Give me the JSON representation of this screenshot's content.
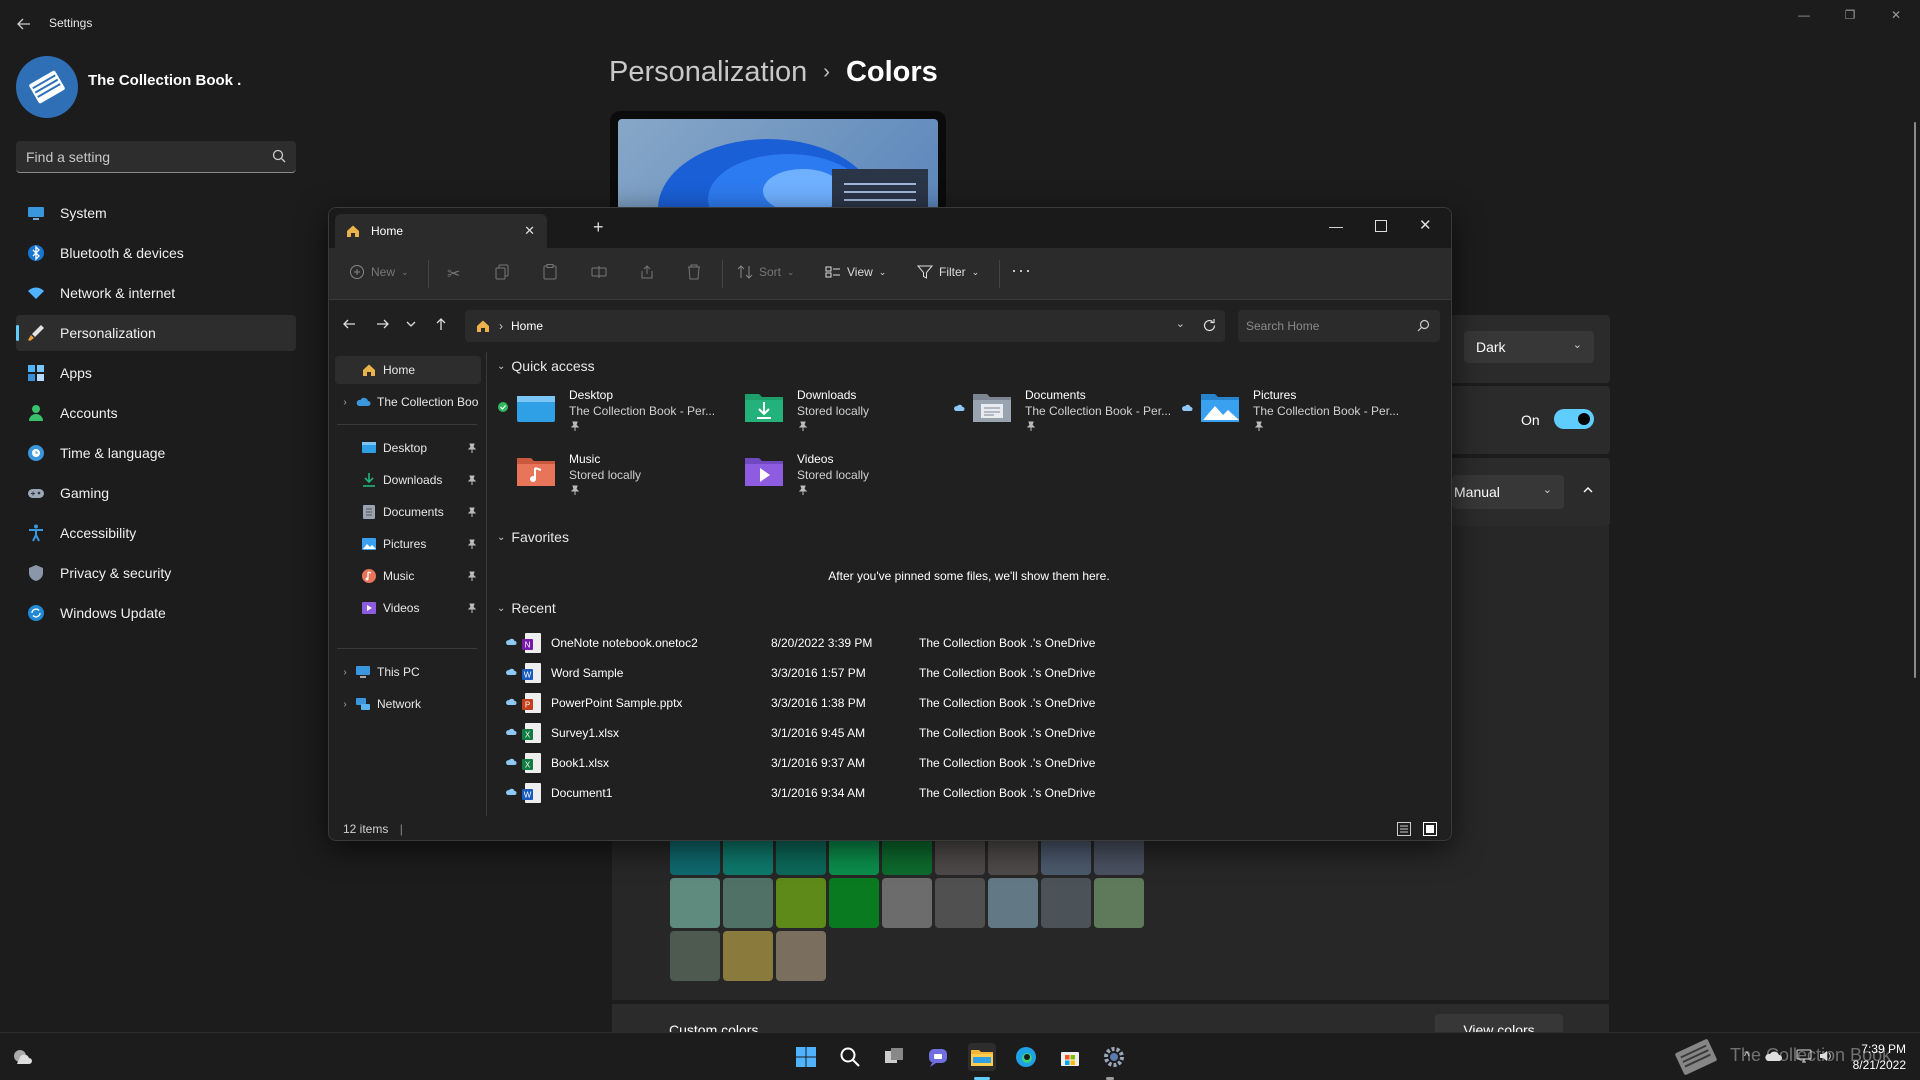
{
  "settings": {
    "window_title": "Settings",
    "username": "The Collection Book .",
    "search_placeholder": "Find a setting",
    "nav": [
      {
        "label": "System",
        "icon": "monitor-icon"
      },
      {
        "label": "Bluetooth & devices",
        "icon": "bluetooth-icon"
      },
      {
        "label": "Network & internet",
        "icon": "wifi-icon"
      },
      {
        "label": "Personalization",
        "icon": "brush-icon",
        "selected": true
      },
      {
        "label": "Apps",
        "icon": "apps-icon"
      },
      {
        "label": "Accounts",
        "icon": "person-icon"
      },
      {
        "label": "Time & language",
        "icon": "globe-clock-icon"
      },
      {
        "label": "Gaming",
        "icon": "gamepad-icon"
      },
      {
        "label": "Accessibility",
        "icon": "accessibility-icon"
      },
      {
        "label": "Privacy & security",
        "icon": "shield-icon"
      },
      {
        "label": "Windows Update",
        "icon": "update-icon"
      }
    ],
    "breadcrumb": {
      "parent": "Personalization",
      "separator": "›",
      "current": "Colors"
    },
    "mode_value": "Dark",
    "transparency_state": "On",
    "accent_value": "Manual",
    "custom_colors_label": "Custom colors",
    "view_colors_label": "View colors",
    "accent_swatches": [
      [
        "#0f6a6f",
        "#0e7a6c",
        "#0c6a5a",
        "#0b8f4c",
        "#0d6b2d",
        "#4f4a4a",
        "#504b4b",
        "#4c5a6e",
        "#4a5262"
      ],
      [
        "#5f8a7e",
        "#4f7166",
        "#5e8a1a",
        "#0a7a20",
        "#6c6c6c",
        "#505050",
        "#637885",
        "#4b5258",
        "#5e7a5a"
      ],
      [
        "#4e5a4f",
        "#8a7a3c",
        "#7a6e5e"
      ]
    ]
  },
  "explorer": {
    "tab_title": "Home",
    "toolbar": {
      "new": "New",
      "sort": "Sort",
      "view": "View",
      "filter": "Filter",
      "more": "···"
    },
    "address": "Home",
    "search_placeholder": "Search Home",
    "sidebar": {
      "home": "Home",
      "onedrive": "The Collection Boo",
      "pinned": [
        {
          "label": "Desktop",
          "icon": "desktop-folder-icon"
        },
        {
          "label": "Downloads",
          "icon": "download-icon"
        },
        {
          "label": "Documents",
          "icon": "documents-icon"
        },
        {
          "label": "Pictures",
          "icon": "pictures-icon"
        },
        {
          "label": "Music",
          "icon": "music-icon"
        },
        {
          "label": "Videos",
          "icon": "videos-icon"
        }
      ],
      "this_pc": "This PC",
      "network": "Network"
    },
    "quick_access_title": "Quick access",
    "quick_access": [
      {
        "name": "Desktop",
        "sub": "The Collection Book - Per...",
        "color": "#2f9fe6",
        "status": "synced"
      },
      {
        "name": "Downloads",
        "sub": "Stored locally",
        "color": "#23b37a",
        "status": ""
      },
      {
        "name": "Documents",
        "sub": "The Collection Book - Per...",
        "color": "#9aa3b0",
        "status": "cloud"
      },
      {
        "name": "Pictures",
        "sub": "The Collection Book - Per...",
        "color": "#3aa0f0",
        "status": "cloud"
      },
      {
        "name": "Music",
        "sub": "Stored locally",
        "color": "#e8745a",
        "status": ""
      },
      {
        "name": "Videos",
        "sub": "Stored locally",
        "color": "#8e5ce0",
        "status": ""
      }
    ],
    "favorites_title": "Favorites",
    "favorites_empty": "After you've pinned some files, we'll show them here.",
    "recent_title": "Recent",
    "recent": [
      {
        "name": "OneNote notebook.onetoc2",
        "date": "8/20/2022 3:39 PM",
        "location": "The Collection Book .'s OneDrive",
        "type": "onenote"
      },
      {
        "name": "Word Sample",
        "date": "3/3/2016 1:57 PM",
        "location": "The Collection Book .'s OneDrive",
        "type": "word"
      },
      {
        "name": "PowerPoint Sample.pptx",
        "date": "3/3/2016 1:38 PM",
        "location": "The Collection Book .'s OneDrive",
        "type": "powerpoint"
      },
      {
        "name": "Survey1.xlsx",
        "date": "3/1/2016 9:45 AM",
        "location": "The Collection Book .'s OneDrive",
        "type": "excel"
      },
      {
        "name": "Book1.xlsx",
        "date": "3/1/2016 9:37 AM",
        "location": "The Collection Book .'s OneDrive",
        "type": "excel"
      },
      {
        "name": "Document1",
        "date": "3/1/2016 9:34 AM",
        "location": "The Collection Book .'s OneDrive",
        "type": "word"
      }
    ],
    "status": "12 items"
  },
  "taskbar": {
    "time": "7:39 PM",
    "date": "8/21/2022",
    "watermark": "The Collection Book"
  },
  "colors": {
    "accent": "#60cdff",
    "background": "#1c1c1c"
  }
}
